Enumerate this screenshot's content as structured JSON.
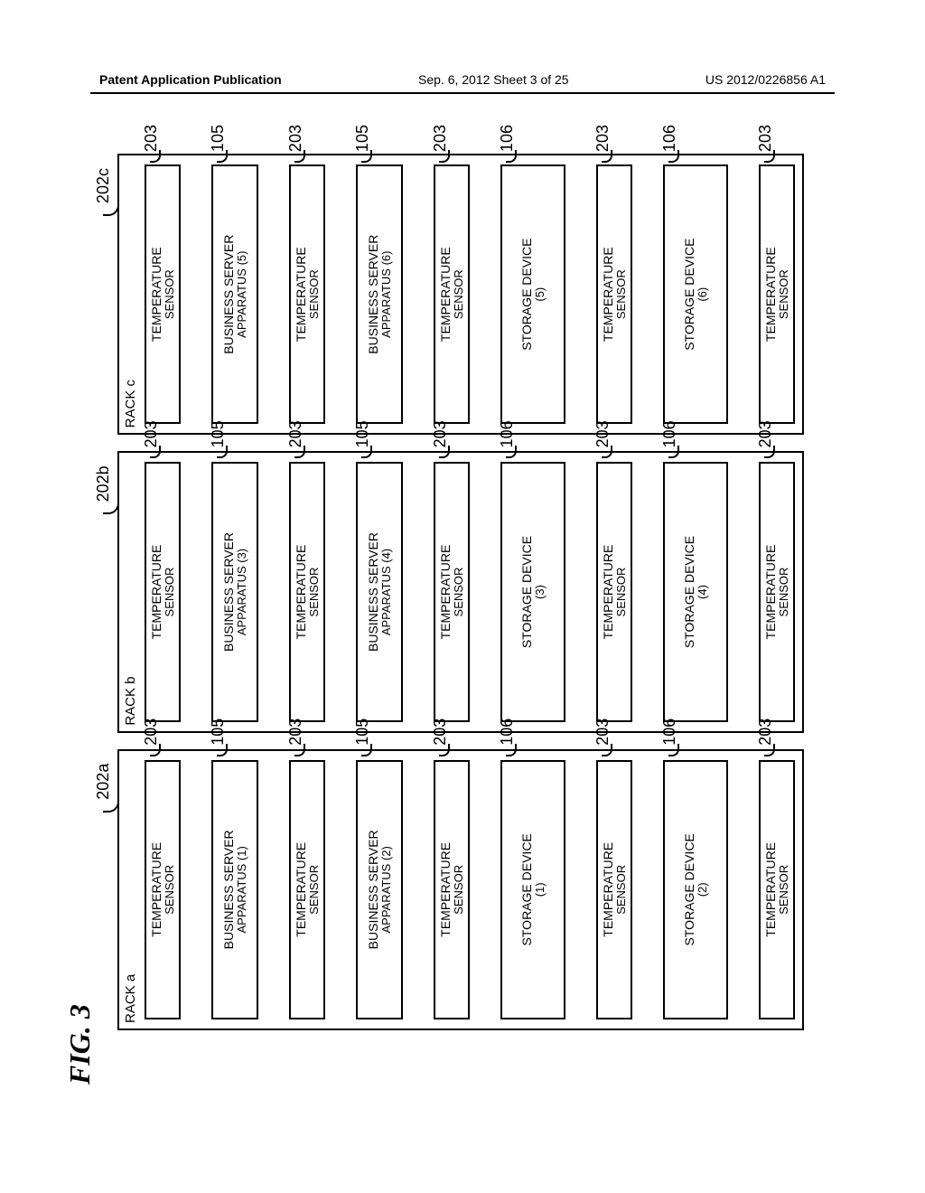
{
  "header": {
    "left": "Patent Application Publication",
    "center": "Sep. 6, 2012  Sheet 3 of 25",
    "right": "US 2012/0226856 A1"
  },
  "figure_label": "FIG. 3",
  "racks": [
    {
      "title": "RACK a",
      "ref": "202a",
      "slots": [
        {
          "kind": "sensor",
          "lines": [
            "TEMPERATURE",
            "SENSOR"
          ],
          "ref": "203"
        },
        {
          "kind": "server",
          "lines": [
            "BUSINESS SERVER",
            "APPARATUS (1)"
          ],
          "ref": "105"
        },
        {
          "kind": "sensor",
          "lines": [
            "TEMPERATURE",
            "SENSOR"
          ],
          "ref": "203"
        },
        {
          "kind": "server",
          "lines": [
            "BUSINESS SERVER",
            "APPARATUS (2)"
          ],
          "ref": "105"
        },
        {
          "kind": "sensor",
          "lines": [
            "TEMPERATURE",
            "SENSOR"
          ],
          "ref": "203"
        },
        {
          "kind": "storage",
          "lines": [
            "STORAGE DEVICE",
            "(1)"
          ],
          "ref": "106"
        },
        {
          "kind": "sensor",
          "lines": [
            "TEMPERATURE",
            "SENSOR"
          ],
          "ref": "203"
        },
        {
          "kind": "storage",
          "lines": [
            "STORAGE DEVICE",
            "(2)"
          ],
          "ref": "106"
        },
        {
          "kind": "sensor",
          "lines": [
            "TEMPERATURE",
            "SENSOR"
          ],
          "ref": "203"
        }
      ]
    },
    {
      "title": "RACK b",
      "ref": "202b",
      "slots": [
        {
          "kind": "sensor",
          "lines": [
            "TEMPERATURE",
            "SENSOR"
          ],
          "ref": "203"
        },
        {
          "kind": "server",
          "lines": [
            "BUSINESS SERVER",
            "APPARATUS (3)"
          ],
          "ref": "105"
        },
        {
          "kind": "sensor",
          "lines": [
            "TEMPERATURE",
            "SENSOR"
          ],
          "ref": "203"
        },
        {
          "kind": "server",
          "lines": [
            "BUSINESS SERVER",
            "APPARATUS (4)"
          ],
          "ref": "105"
        },
        {
          "kind": "sensor",
          "lines": [
            "TEMPERATURE",
            "SENSOR"
          ],
          "ref": "203"
        },
        {
          "kind": "storage",
          "lines": [
            "STORAGE DEVICE",
            "(3)"
          ],
          "ref": "106"
        },
        {
          "kind": "sensor",
          "lines": [
            "TEMPERATURE",
            "SENSOR"
          ],
          "ref": "203"
        },
        {
          "kind": "storage",
          "lines": [
            "STORAGE DEVICE",
            "(4)"
          ],
          "ref": "106"
        },
        {
          "kind": "sensor",
          "lines": [
            "TEMPERATURE",
            "SENSOR"
          ],
          "ref": "203"
        }
      ]
    },
    {
      "title": "RACK c",
      "ref": "202c",
      "slots": [
        {
          "kind": "sensor",
          "lines": [
            "TEMPERATURE",
            "SENSOR"
          ],
          "ref": "203"
        },
        {
          "kind": "server",
          "lines": [
            "BUSINESS SERVER",
            "APPARATUS (5)"
          ],
          "ref": "105"
        },
        {
          "kind": "sensor",
          "lines": [
            "TEMPERATURE",
            "SENSOR"
          ],
          "ref": "203"
        },
        {
          "kind": "server",
          "lines": [
            "BUSINESS SERVER",
            "APPARATUS (6)"
          ],
          "ref": "105"
        },
        {
          "kind": "sensor",
          "lines": [
            "TEMPERATURE",
            "SENSOR"
          ],
          "ref": "203"
        },
        {
          "kind": "storage",
          "lines": [
            "STORAGE DEVICE",
            "(5)"
          ],
          "ref": "106"
        },
        {
          "kind": "sensor",
          "lines": [
            "TEMPERATURE",
            "SENSOR"
          ],
          "ref": "203"
        },
        {
          "kind": "storage",
          "lines": [
            "STORAGE DEVICE",
            "(6)"
          ],
          "ref": "106"
        },
        {
          "kind": "sensor",
          "lines": [
            "TEMPERATURE",
            "SENSOR"
          ],
          "ref": "203"
        }
      ]
    }
  ]
}
